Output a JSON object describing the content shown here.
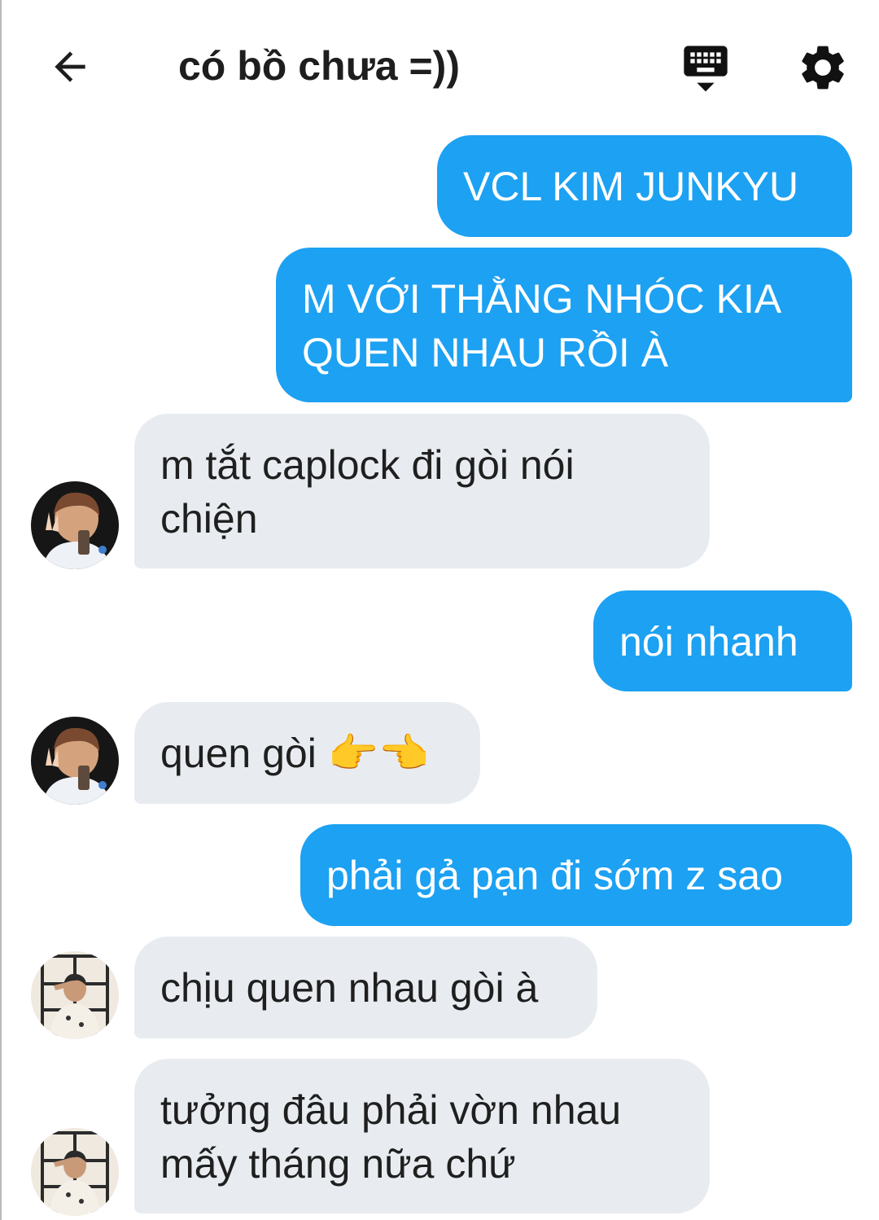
{
  "header": {
    "title": "có bồ chưa =))"
  },
  "icons": {
    "back": "arrow-left-icon",
    "keyboard": "keyboard-icon",
    "settings": "gear-icon"
  },
  "colors": {
    "sent_bubble": "#1da1f2",
    "received_bubble": "#e8ecf0",
    "sent_text": "#ffffff",
    "received_text": "#1f1f1f"
  },
  "messages": [
    {
      "direction": "sent",
      "lines": [
        "VCL KIM JUNKYU"
      ]
    },
    {
      "direction": "sent",
      "lines": [
        "M VỚI THẰNG NHÓC KIA",
        "QUEN NHAU RỒI À"
      ]
    },
    {
      "direction": "received",
      "sender": "contact-1",
      "lines": [
        "m tắt caplock đi gòi nói",
        "chiện"
      ]
    },
    {
      "direction": "sent",
      "lines": [
        "nói nhanh"
      ]
    },
    {
      "direction": "received",
      "sender": "contact-1",
      "lines": [
        "quen gòi 👉👈"
      ]
    },
    {
      "direction": "sent",
      "lines": [
        "phải gả pạn đi sớm z sao"
      ]
    },
    {
      "direction": "received",
      "sender": "contact-2",
      "lines": [
        "chịu quen nhau gòi à"
      ]
    },
    {
      "direction": "received",
      "sender": "contact-2",
      "lines": [
        "tưởng đâu phải vờn nhau",
        "mấy tháng nữa chứ"
      ]
    }
  ]
}
